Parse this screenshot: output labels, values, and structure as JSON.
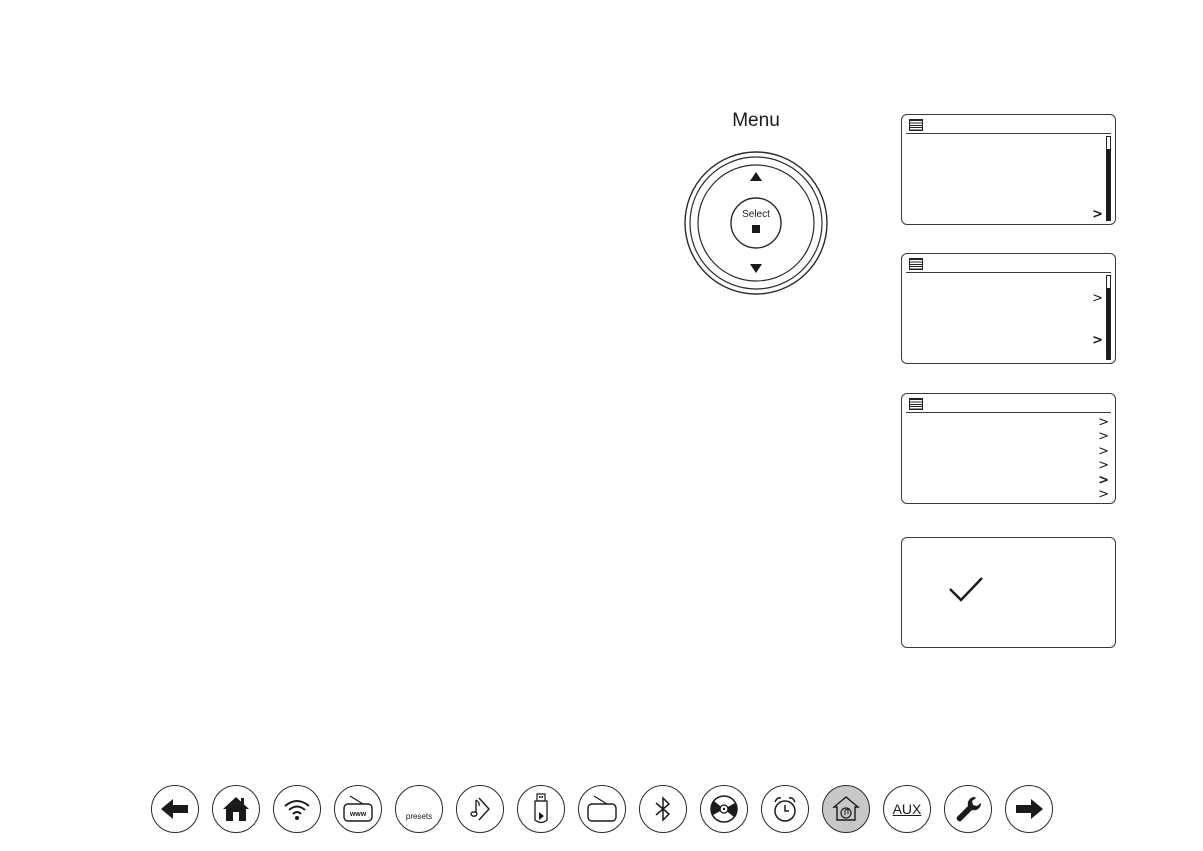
{
  "controller": {
    "menu_label": "Menu",
    "select_label": "Select"
  },
  "screens": [
    {
      "name": "screen-1",
      "scroll_fraction": 0.85,
      "chevrons": [
        ">"
      ]
    },
    {
      "name": "screen-2",
      "scroll_fraction": 0.85,
      "chevrons": [
        ">",
        ">"
      ]
    },
    {
      "name": "screen-3",
      "chevrons": [
        ">",
        ">",
        ">",
        ">",
        ">",
        ">"
      ]
    },
    {
      "name": "screen-4",
      "icon": "checkmark-icon"
    }
  ],
  "nav": {
    "buttons": [
      {
        "name": "back-arrow-icon"
      },
      {
        "name": "home-icon"
      },
      {
        "name": "wifi-icon"
      },
      {
        "name": "internet-radio-icon",
        "text": "www"
      },
      {
        "name": "presets-icon",
        "text": "presets"
      },
      {
        "name": "music-player-icon"
      },
      {
        "name": "usb-icon"
      },
      {
        "name": "radio-icon"
      },
      {
        "name": "bluetooth-icon"
      },
      {
        "name": "cd-icon"
      },
      {
        "name": "alarm-clock-icon"
      },
      {
        "name": "home-music-icon",
        "active": true
      },
      {
        "name": "aux-icon",
        "text": "AUX"
      },
      {
        "name": "wrench-icon"
      },
      {
        "name": "forward-arrow-icon"
      }
    ]
  },
  "colors": {
    "line": "#2a2a2a",
    "active_button": "#c8c8c8"
  }
}
